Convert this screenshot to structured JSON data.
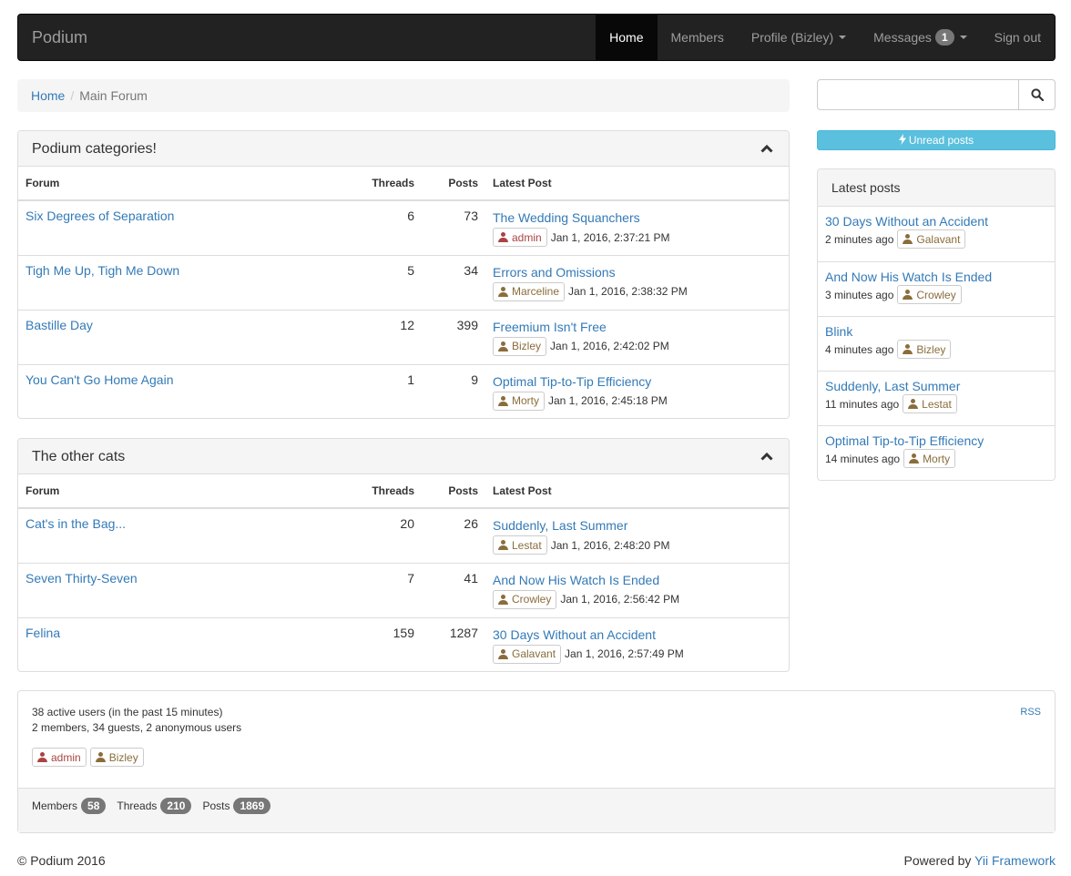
{
  "navbar": {
    "brand": "Podium",
    "items": [
      {
        "label": "Home"
      },
      {
        "label": "Members"
      },
      {
        "label": "Profile (Bizley)"
      },
      {
        "label": "Messages",
        "badge": "1"
      },
      {
        "label": "Sign out"
      }
    ]
  },
  "breadcrumb": {
    "home": "Home",
    "current": "Main Forum"
  },
  "table_headers": {
    "forum": "Forum",
    "threads": "Threads",
    "posts": "Posts",
    "latest": "Latest Post"
  },
  "categories": [
    {
      "title": "Podium categories!",
      "forums": [
        {
          "name": "Six Degrees of Separation",
          "threads": "6",
          "posts": "73",
          "latest_title": "The Wedding Squanchers",
          "latest_user": "admin",
          "latest_date": "Jan 1, 2016, 2:37:21 PM"
        },
        {
          "name": "Tigh Me Up, Tigh Me Down",
          "threads": "5",
          "posts": "34",
          "latest_title": "Errors and Omissions",
          "latest_user": "Marceline",
          "latest_date": "Jan 1, 2016, 2:38:32 PM"
        },
        {
          "name": "Bastille Day",
          "threads": "12",
          "posts": "399",
          "latest_title": "Freemium Isn't Free",
          "latest_user": "Bizley",
          "latest_date": "Jan 1, 2016, 2:42:02 PM"
        },
        {
          "name": "You Can't Go Home Again",
          "threads": "1",
          "posts": "9",
          "latest_title": "Optimal Tip-to-Tip Efficiency",
          "latest_user": "Morty",
          "latest_date": "Jan 1, 2016, 2:45:18 PM"
        }
      ]
    },
    {
      "title": "The other cats",
      "forums": [
        {
          "name": "Cat's in the Bag...",
          "threads": "20",
          "posts": "26",
          "latest_title": "Suddenly, Last Summer",
          "latest_user": "Lestat",
          "latest_date": "Jan 1, 2016, 2:48:20 PM"
        },
        {
          "name": "Seven Thirty-Seven",
          "threads": "7",
          "posts": "41",
          "latest_title": "And Now His Watch Is Ended",
          "latest_user": "Crowley",
          "latest_date": "Jan 1, 2016, 2:56:42 PM"
        },
        {
          "name": "Felina",
          "threads": "159",
          "posts": "1287",
          "latest_title": "30 Days Without an Accident",
          "latest_user": "Galavant",
          "latest_date": "Jan 1, 2016, 2:57:49 PM"
        }
      ]
    }
  ],
  "search": {
    "placeholder": ""
  },
  "unread_button": "Unread posts",
  "latest_posts": {
    "title": "Latest posts",
    "items": [
      {
        "title": "30 Days Without an Accident",
        "ago": "2 minutes ago",
        "user": "Galavant"
      },
      {
        "title": "And Now His Watch Is Ended",
        "ago": "3 minutes ago",
        "user": "Crowley"
      },
      {
        "title": "Blink",
        "ago": "4 minutes ago",
        "user": "Bizley"
      },
      {
        "title": "Suddenly, Last Summer",
        "ago": "11 minutes ago",
        "user": "Lestat"
      },
      {
        "title": "Optimal Tip-to-Tip Efficiency",
        "ago": "14 minutes ago",
        "user": "Morty"
      }
    ]
  },
  "online": {
    "active": "38 active users (in the past 15 minutes)",
    "breakdown": "2 members, 34 guests, 2 anonymous users",
    "users": [
      {
        "name": "admin",
        "role": "admin"
      },
      {
        "name": "Bizley",
        "role": "user"
      }
    ],
    "rss": "RSS"
  },
  "stats": {
    "members_label": "Members",
    "members": "58",
    "threads_label": "Threads",
    "threads": "210",
    "posts_label": "Posts",
    "posts": "1869"
  },
  "footer": {
    "copyright": "© Podium 2016",
    "powered_prefix": "Powered by",
    "powered_link": "Yii Framework"
  },
  "colors": {
    "admin": "#a94442",
    "user": "#8a6d3b",
    "link": "#337ab7",
    "info": "#5bc0de"
  }
}
